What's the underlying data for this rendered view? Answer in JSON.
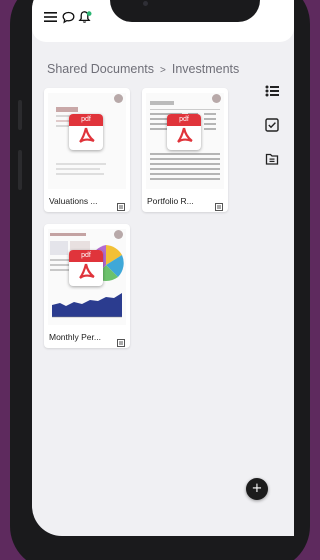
{
  "breadcrumb": {
    "root": "Shared Documents",
    "separator": ">",
    "current": "Investments"
  },
  "header": {
    "menu_icon": "hamburger-menu-icon",
    "chat_icon": "speech-bubble-icon",
    "notification_icon": "bell-icon"
  },
  "files": [
    {
      "name": "Valuations ...",
      "type_label": "pdf",
      "thumb": "valuation-report"
    },
    {
      "name": "Portfolio R...",
      "type_label": "pdf",
      "thumb": "portfolio-table"
    },
    {
      "name": "Monthly Per...",
      "type_label": "pdf",
      "thumb": "performance-chart"
    }
  ],
  "right_rail": [
    "list-view-icon",
    "checkbox-icon",
    "folder-doc-icon"
  ],
  "fab": {
    "label": "+"
  },
  "colors": {
    "pdf_red": "#e0343b",
    "background": "#5e2a5e",
    "screen": "#f0f0f3"
  }
}
